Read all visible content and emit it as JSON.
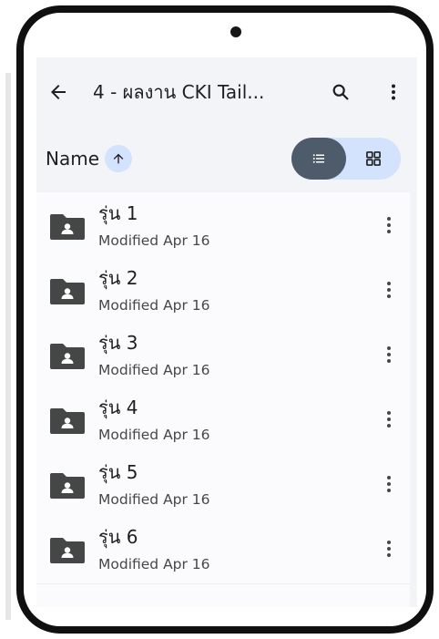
{
  "app": {
    "title": "4 - ผลงาน CKI Tail...",
    "back_icon": "arrow-back-icon",
    "search_icon": "search-icon",
    "more_icon": "more-vert-icon"
  },
  "sort": {
    "label": "Name",
    "direction_icon": "arrow-upward-icon"
  },
  "view_toggle": {
    "selected": "list",
    "list_icon": "list-view-icon",
    "grid_icon": "grid-view-icon"
  },
  "items": [
    {
      "name": "รุ่น 1",
      "modified": "Modified Apr 16"
    },
    {
      "name": "รุ่น 2",
      "modified": "Modified Apr 16"
    },
    {
      "name": "รุ่น 3",
      "modified": "Modified Apr 16"
    },
    {
      "name": "รุ่น 4",
      "modified": "Modified Apr 16"
    },
    {
      "name": "รุ่น 5",
      "modified": "Modified Apr 16"
    },
    {
      "name": "รุ่น 6",
      "modified": "Modified Apr 16"
    }
  ],
  "colors": {
    "accent": "#d3e3fd",
    "selected": "#4d5b6a",
    "folder": "#444746",
    "background": "#f3f4f8"
  }
}
